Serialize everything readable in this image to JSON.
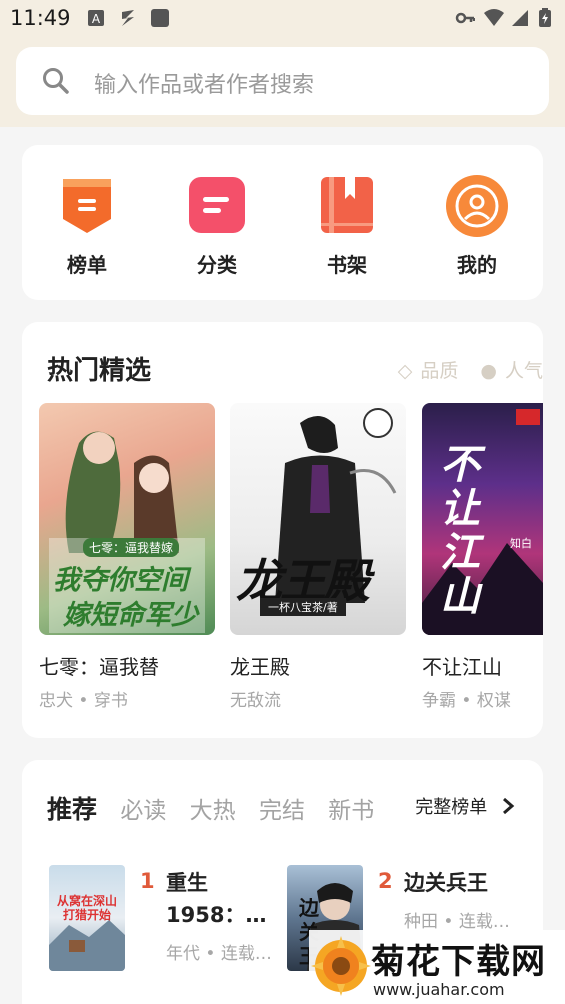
{
  "status_bar": {
    "time": "11:49"
  },
  "search": {
    "placeholder": "输入作品或者作者搜索"
  },
  "nav": [
    {
      "label": "榜单",
      "icon": "ranking-icon",
      "color": "#f36b2b"
    },
    {
      "label": "分类",
      "icon": "category-icon",
      "color": "#f4506a"
    },
    {
      "label": "书架",
      "icon": "bookshelf-icon",
      "color": "#f26248"
    },
    {
      "label": "我的",
      "icon": "profile-icon",
      "color": "#f7893a"
    }
  ],
  "hot": {
    "title": "热门精选",
    "tag_quality": "品质",
    "tag_popular": "人气",
    "books": [
      {
        "title": "七零：逼我替",
        "tags": "忠犬 • 穿书",
        "cover_text_1": "七零：逼我替嫁",
        "cover_text_2": "我夺你空间",
        "cover_text_3": "嫁短命军少"
      },
      {
        "title": "龙王殿",
        "tags": "无敌流",
        "cover_text_1": "龙王殿",
        "cover_text_2": "一杯八宝茶/著"
      },
      {
        "title": "不让江山",
        "tags": "争霸 • 权谋",
        "cover_text_1": "不让江山",
        "cover_text_2": "知白"
      }
    ]
  },
  "rec": {
    "tabs": [
      "推荐",
      "必读",
      "大热",
      "完结",
      "新书"
    ],
    "full_label": "完整榜单",
    "books": [
      {
        "rank": "1",
        "title": "重生1958：…",
        "tags": "年代 • 连载…"
      },
      {
        "rank": "2",
        "title": "边关兵王",
        "tags": "种田 • 连载…"
      }
    ]
  },
  "watermark": {
    "main": "菊花下载网",
    "url": "www.juahar.com"
  }
}
